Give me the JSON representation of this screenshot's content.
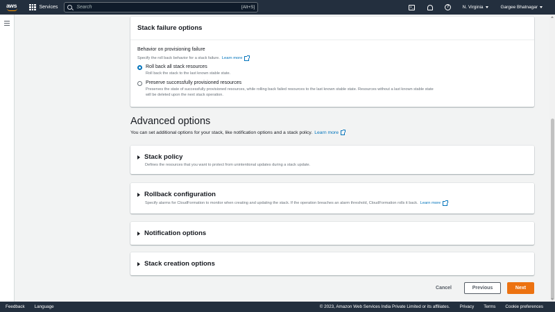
{
  "topnav": {
    "logo_text": "aws",
    "services_label": "Services",
    "search_placeholder": "Search",
    "search_shortcut": "[Alt+S]",
    "region": "N. Virginia",
    "user": "Gargee Bhatnagar"
  },
  "failure_options": {
    "title": "Stack failure options",
    "behavior_label": "Behavior on provisioning failure",
    "behavior_desc": "Specify the roll back behavior for a stack failure.",
    "learn_more": "Learn more",
    "options": [
      {
        "label": "Roll back all stack resources",
        "desc": "Roll back the stack to the last known stable state.",
        "checked": true
      },
      {
        "label": "Preserve successfully provisioned resources",
        "desc": "Preserves the state of successfully provisioned resources, while rolling back failed resources to the last known stable state. Resources without a last known stable state will be deleted upon the next stack operation.",
        "checked": false
      }
    ]
  },
  "advanced": {
    "title": "Advanced options",
    "desc": "You can set additional options for your stack, like notification options and a stack policy.",
    "learn_more": "Learn more",
    "sections": [
      {
        "title": "Stack policy",
        "desc": "Defines the resources that you want to protect from unintentional updates during a stack update."
      },
      {
        "title": "Rollback configuration",
        "desc": "Specify alarms for CloudFormation to monitor when creating and updating the stack. If the operation breaches an alarm threshold, CloudFormation rolls it back.",
        "learn_more": "Learn more"
      },
      {
        "title": "Notification options"
      },
      {
        "title": "Stack creation options"
      }
    ]
  },
  "buttons": {
    "cancel": "Cancel",
    "previous": "Previous",
    "next": "Next"
  },
  "footer": {
    "feedback": "Feedback",
    "language": "Language",
    "copyright": "© 2023, Amazon Web Services India Private Limited or its affiliates.",
    "privacy": "Privacy",
    "terms": "Terms",
    "cookie": "Cookie preferences"
  },
  "colors": {
    "nav_bg": "#232f3e",
    "accent_orange": "#ec7211",
    "link_blue": "#0073bb"
  }
}
